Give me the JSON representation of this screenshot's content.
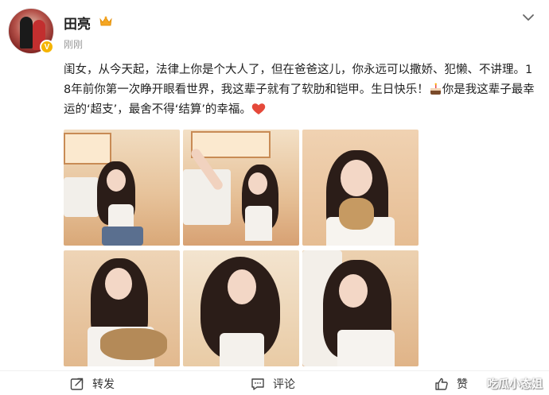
{
  "user": {
    "name": "田亮",
    "verified_badge": "V",
    "timestamp": "刚刚",
    "avatar_icon": "avatar-image",
    "crown_icon": "crown-icon",
    "crown_color": "#f5a623"
  },
  "post": {
    "text_part1": "闺女，从今天起，法律上你是个大人了，但在爸爸这儿，你永远可以撒娇、犯懒、不讲理。18年前你第一次睁开眼看世界，我这辈子就有了软肋和铠甲。生日快乐！",
    "text_part2": "你是我这辈子最幸运的‘超支’，最舍不得‘结算’的幸福。",
    "cake_icon": "cake-emoji-icon",
    "heart_icon": "heart-emoji-icon",
    "heart_color": "#e5493a"
  },
  "photos": [
    {
      "scene": "girl-sitting-by-window"
    },
    {
      "scene": "girl-arm-raised"
    },
    {
      "scene": "girl-holding-cat"
    },
    {
      "scene": "girl-with-cat-in-arms"
    },
    {
      "scene": "girl-hair-flowing"
    },
    {
      "scene": "girl-eyes-closed-smiling"
    }
  ],
  "actions": {
    "repost_label": "转发",
    "comment_label": "评论",
    "like_label": "赞"
  },
  "watermark": "吃瓜小态姐"
}
